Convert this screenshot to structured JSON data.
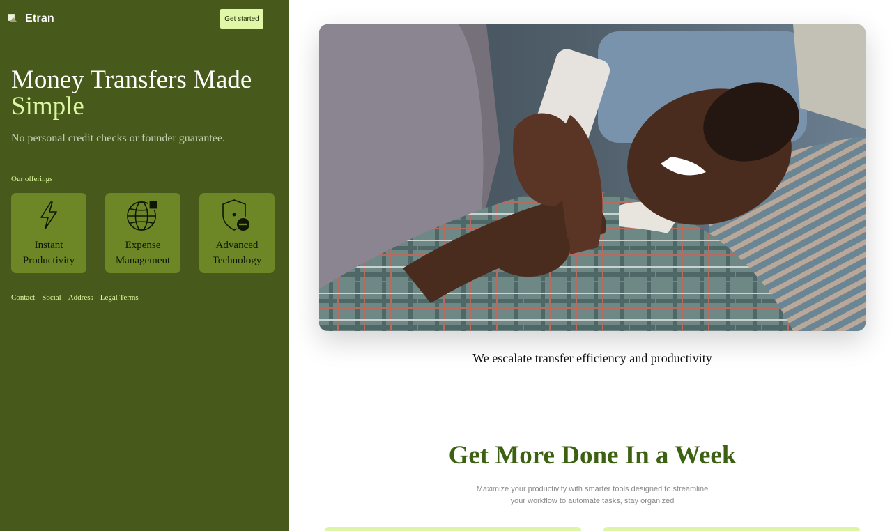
{
  "brand": {
    "name": "Etran",
    "logo_icon": "broken-image-icon"
  },
  "header": {
    "cta_label": "Get started"
  },
  "hero": {
    "title_line1": "Money Transfers Made",
    "title_line2": "Simple",
    "subtitle": "No personal credit checks or founder guarantee."
  },
  "offerings": {
    "label": "Our offerings",
    "items": [
      {
        "line1": "Instant",
        "line2": "Productivity",
        "icon": "lightning-icon"
      },
      {
        "line1": "Expense",
        "line2": "Management",
        "icon": "globe-icon"
      },
      {
        "line1": "Advanced",
        "line2": "Technology",
        "icon": "shield-icon"
      }
    ]
  },
  "footer": {
    "links": [
      "Contact",
      "Social",
      "Address",
      "Legal Terms"
    ]
  },
  "main": {
    "photo_caption": "We escalate transfer efficiency and productivity",
    "section_title": "Get More Done In a Week",
    "section_desc_line1": "Maximize your productivity with smarter tools designed to streamline",
    "section_desc_line2": "your workflow to automate tasks, stay organized"
  },
  "colors": {
    "sidebar_bg": "#485a1b",
    "accent_light": "#dbf8a1",
    "card_bg": "#6d8626",
    "title_green": "#3d6112"
  }
}
